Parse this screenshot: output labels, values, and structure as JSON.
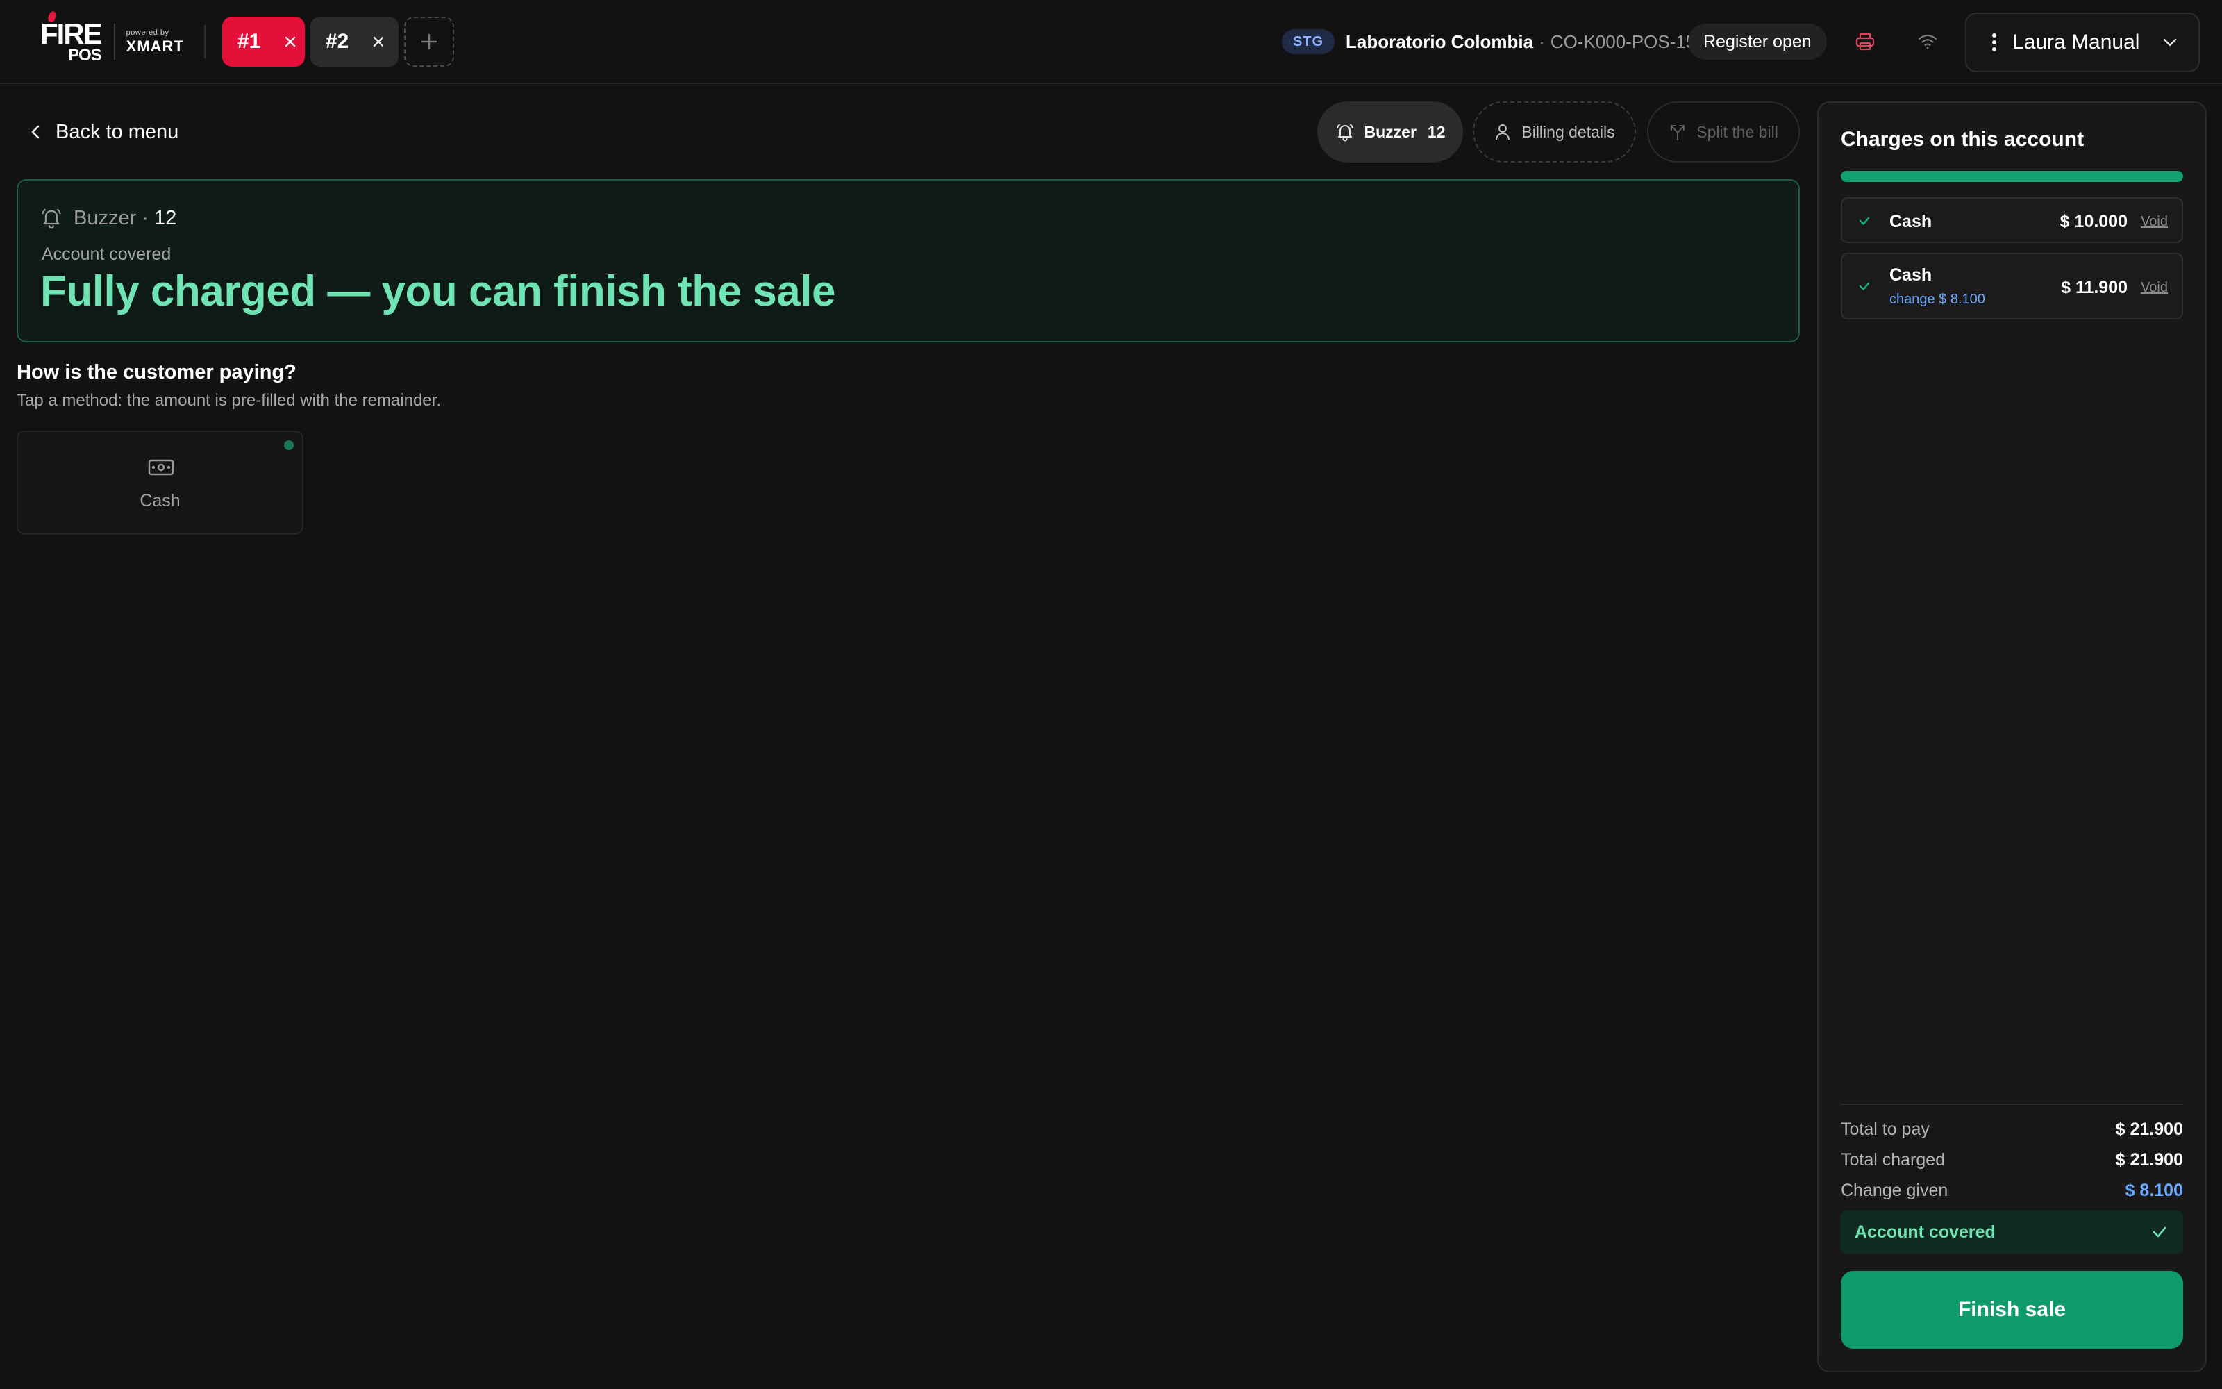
{
  "app": {
    "logo_main": "FIRE",
    "logo_sub": "POS",
    "logo_powered": "powered by",
    "logo_partner": "XMART"
  },
  "tabs": [
    {
      "label": "#1",
      "active": true
    },
    {
      "label": "#2",
      "active": false
    }
  ],
  "header": {
    "env_badge": "STG",
    "store": "Laboratorio Colombia",
    "separator": "·",
    "device": "CO-K000-POS-15",
    "register_status": "Register open",
    "user_name": "Laura Manual"
  },
  "nav": {
    "back_label": "Back to menu"
  },
  "actions": {
    "buzzer_label": "Buzzer",
    "buzzer_value": "12",
    "billing_label": "Billing details",
    "split_label": "Split the bill"
  },
  "status": {
    "buzzer_label": "Buzzer ·",
    "buzzer_value": "12",
    "covered_label": "Account covered",
    "headline": "Fully charged — you can finish the sale"
  },
  "payment": {
    "question": "How is the customer paying?",
    "hint": "Tap a method: the amount is pre-filled with the remainder.",
    "methods": [
      {
        "label": "Cash",
        "icon": "cash-icon"
      }
    ]
  },
  "charges": {
    "title": "Charges on this account",
    "progress_fraction": 1.0,
    "items": [
      {
        "method": "Cash",
        "amount": "$ 10.000",
        "void_label": "Void",
        "change": ""
      },
      {
        "method": "Cash",
        "amount": "$ 11.900",
        "void_label": "Void",
        "change": "change $ 8.100"
      }
    ],
    "totals": {
      "to_pay_label": "Total to pay",
      "to_pay_value": "$ 21.900",
      "charged_label": "Total charged",
      "charged_value": "$ 21.900",
      "change_label": "Change given",
      "change_value": "$ 8.100"
    },
    "covered_label": "Account covered",
    "finish_label": "Finish sale"
  },
  "colors": {
    "brand_red": "#e4103a",
    "accent_green": "#0e9a6c",
    "headline_green": "#6fe3b3",
    "change_blue": "#6aa7ff"
  }
}
